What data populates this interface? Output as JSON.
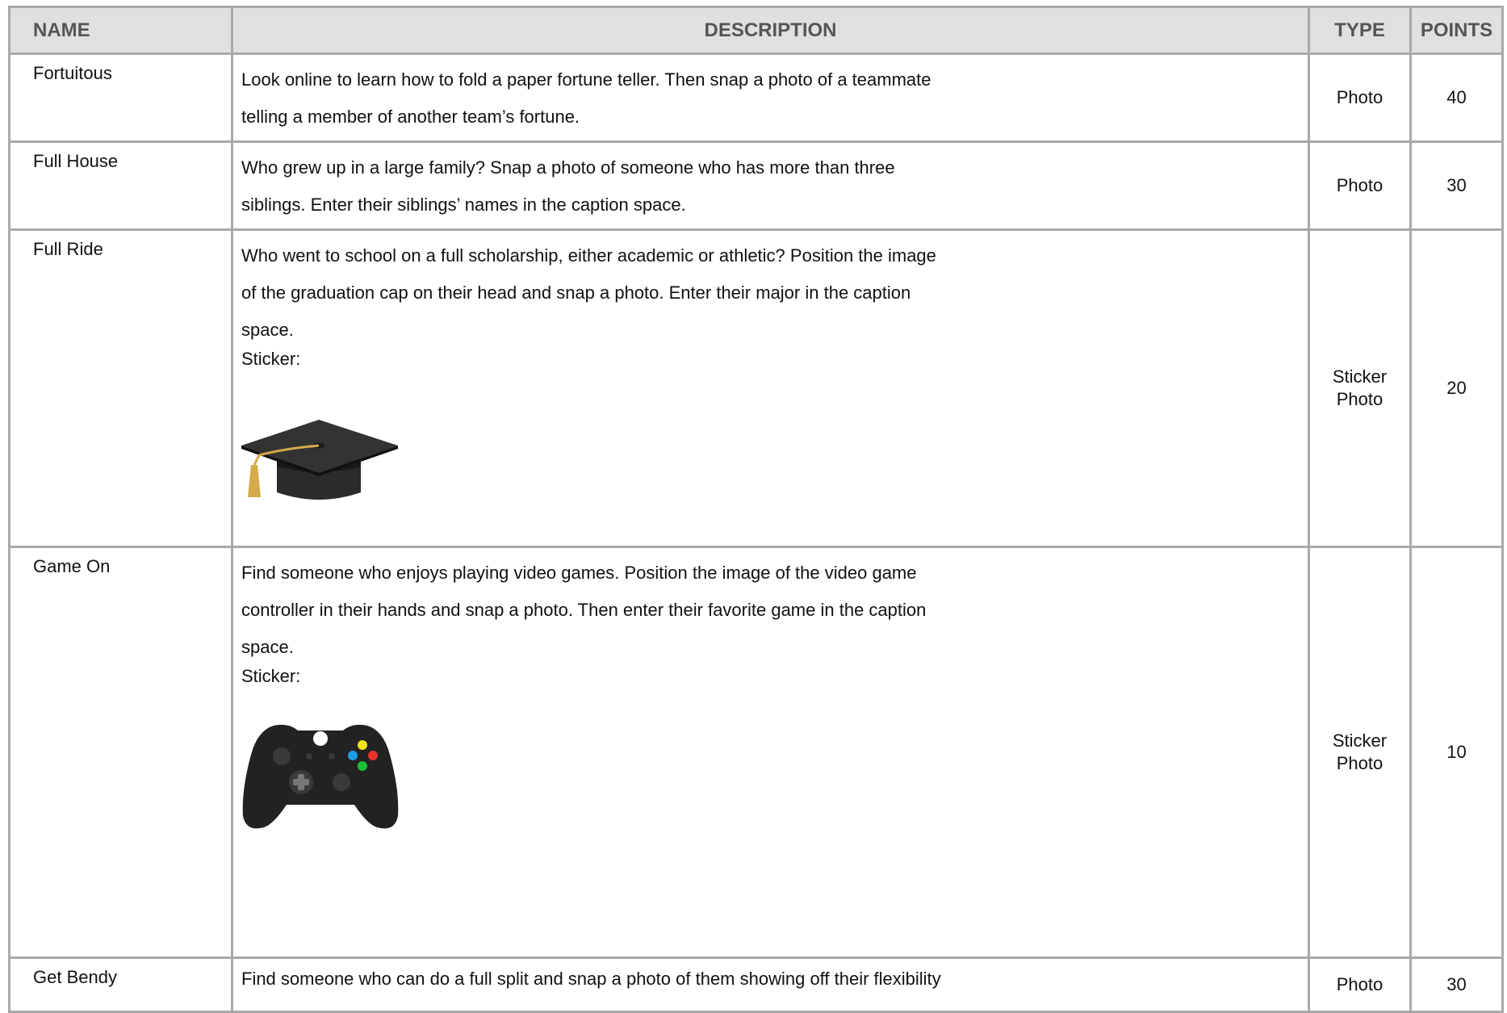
{
  "headers": {
    "name": "NAME",
    "description": "DESCRIPTION",
    "type": "TYPE",
    "points": "POINTS"
  },
  "rows": [
    {
      "name": "Fortuitous",
      "description": "Look online to learn how to fold a paper fortune teller. Then snap a photo of a teammate telling a member of another team’s fortune.",
      "sticker_label": "",
      "sticker_icon": "",
      "type": [
        "Photo"
      ],
      "points": "40"
    },
    {
      "name": "Full House",
      "description": "Who grew up in a large family? Snap a photo of someone who has more than three siblings. Enter their siblings’ names in the caption space.",
      "sticker_label": "",
      "sticker_icon": "",
      "type": [
        "Photo"
      ],
      "points": "30"
    },
    {
      "name": "Full Ride",
      "description": "Who went to school on a full scholarship, either academic or athletic? Position the image of the graduation cap on their head and snap a photo. Enter their major in the caption space.",
      "sticker_label": "Sticker:",
      "sticker_icon": "graduation-cap-icon",
      "type": [
        "Sticker",
        "Photo"
      ],
      "points": "20"
    },
    {
      "name": "Game On",
      "description": "Find someone who enjoys playing video games. Position the image of the video game controller in their hands and snap a photo. Then enter their favorite game in the caption space.",
      "sticker_label": "Sticker:",
      "sticker_icon": "game-controller-icon",
      "type": [
        "Sticker",
        "Photo"
      ],
      "points": "10"
    },
    {
      "name": "Get Bendy",
      "description": "Find someone who can do a full split and snap a photo of them showing off their flexibility",
      "sticker_label": "",
      "sticker_icon": "",
      "type": [
        "Photo"
      ],
      "points": "30"
    }
  ]
}
